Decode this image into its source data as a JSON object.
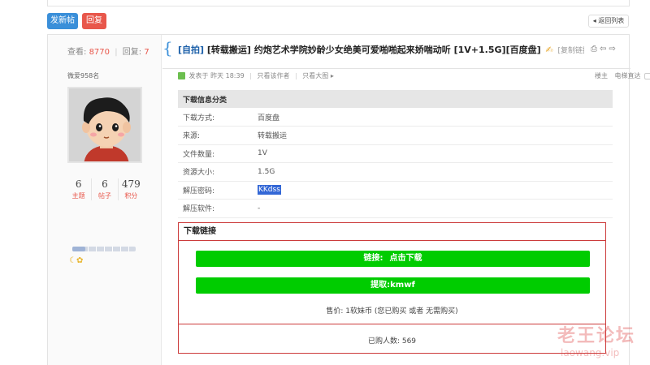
{
  "toolbar": {
    "new_post_label": "发新帖",
    "reply_label": "回复",
    "back_label": "返回列表"
  },
  "thread": {
    "views_label": "查看:",
    "views": "8770",
    "replies_label": "回复:",
    "replies": "7",
    "category": "[自拍]",
    "title": "[转载搬运] 约炮艺术学院妙龄少女绝美可爱啪啪起来娇喘动听 [1V+1.5G][百度盘]",
    "copy_link_label": "[复制链接]"
  },
  "author": {
    "name": "微爱958名",
    "stats": [
      {
        "value": "6",
        "label": "主题"
      },
      {
        "value": "6",
        "label": "帖子"
      },
      {
        "value": "479",
        "label": "积分"
      }
    ],
    "level_progress": 0.2,
    "medals": "☾✿"
  },
  "post": {
    "posted_at": "发表于 昨天 18:39",
    "only_author_label": "只看该作者",
    "only_image_label": "只看大图",
    "floor_label": "楼主",
    "e_reading_label": "电梯直达"
  },
  "download_info": {
    "header": "下载信息分类",
    "rows": [
      {
        "key": "下载方式:",
        "value": "百度盘"
      },
      {
        "key": "来源:",
        "value": "转载搬运"
      },
      {
        "key": "文件数量:",
        "value": "1V"
      },
      {
        "key": "资源大小:",
        "value": "1.5G"
      },
      {
        "key": "解压密码:",
        "value": "KKdss"
      },
      {
        "key": "解压软件:",
        "value": "-"
      }
    ]
  },
  "download_box": {
    "title": "下载链接",
    "link_label": "链接:",
    "link_text": "点击下载",
    "code_label": "提取:",
    "code": "kmwf",
    "price_text": "售价:  1软妹币  (您已购买 或者 无需购买)",
    "buyers_text": "已购人数:  569"
  },
  "watermark": {
    "line1": "老王论坛",
    "line2": "laowang.vip"
  }
}
